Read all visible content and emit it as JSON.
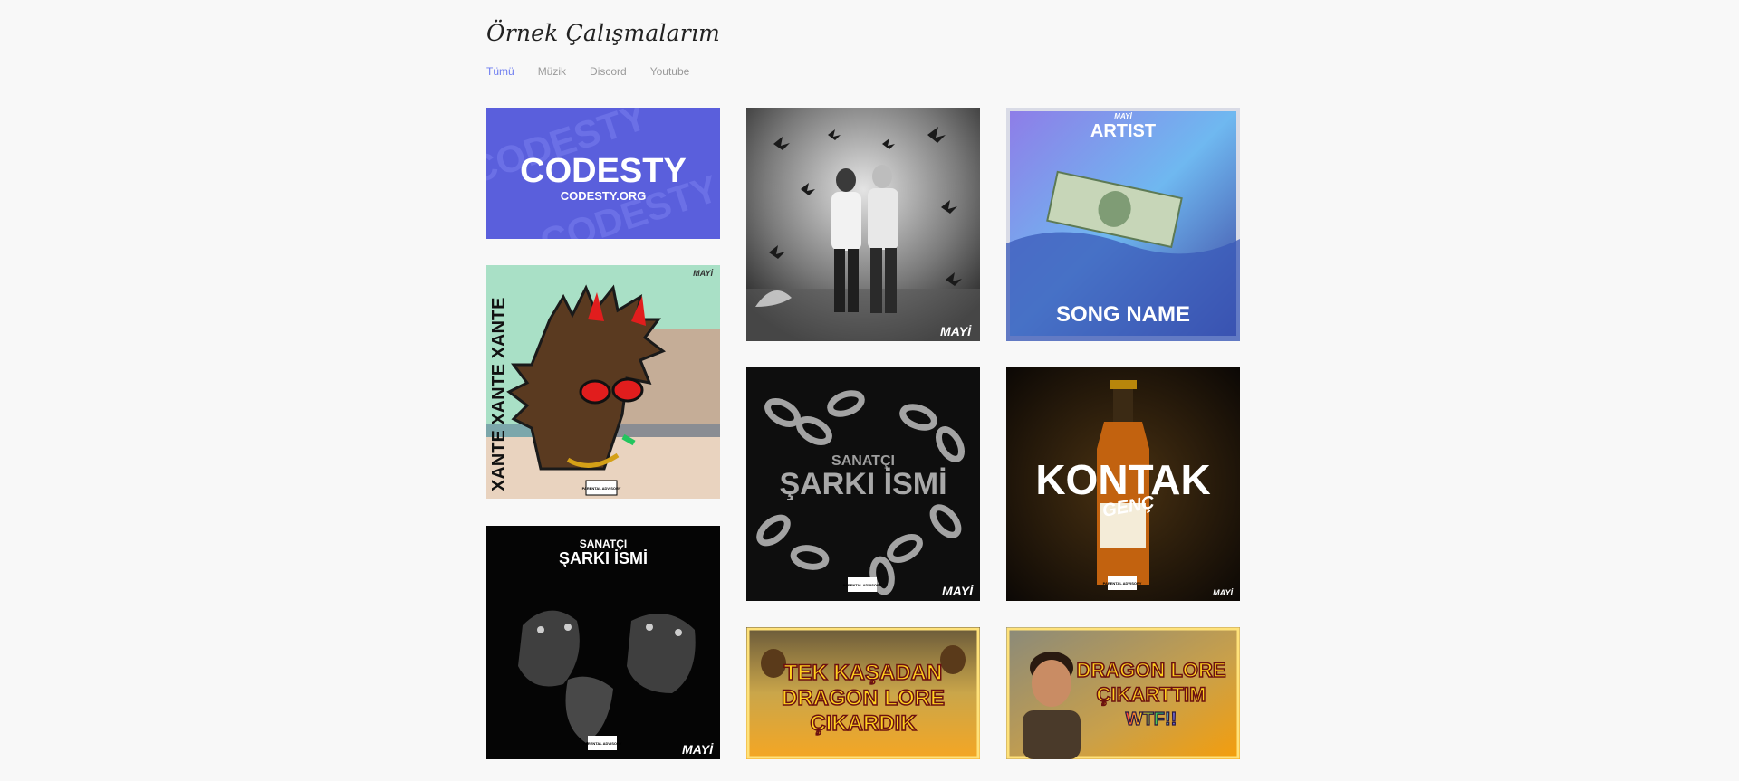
{
  "header": {
    "title": "Örnek Çalışmalarım"
  },
  "filters": [
    {
      "label": "Tümü",
      "active": true
    },
    {
      "label": "Müzik",
      "active": false
    },
    {
      "label": "Discord",
      "active": false
    },
    {
      "label": "Youtube",
      "active": false
    }
  ],
  "portfolio": {
    "codesty": {
      "title": "CODESTY",
      "subtitle": "CODESTY.ORG",
      "bg_text": "CODESTY"
    },
    "duo": {
      "signature": "MAYİ"
    },
    "artist": {
      "top_tag": "MAYİ",
      "artist": "ARTIST",
      "song": "SONG NAME"
    },
    "xante": {
      "side_text": "XANTE XANTE XANTE",
      "signature": "MAYİ",
      "advisory": "PARENTAL ADVISORY"
    },
    "chains": {
      "artist": "SANATÇI",
      "song": "ŞARKI İSMİ",
      "signature": "MAYİ",
      "advisory": "PARENTAL ADVISORY"
    },
    "kontak": {
      "title": "KONTAK",
      "subtitle": "GENÇ",
      "signature": "MAYİ",
      "advisory": "PARENTAL ADVISORY"
    },
    "dogs": {
      "artist": "SANATÇI",
      "song": "ŞARKI İSMİ",
      "signature": "MAYİ",
      "advisory": "PARENTAL ADVISORY"
    },
    "tek": {
      "line1": "TEK KAŞADAN",
      "line2": "DRAGON LORE",
      "line3": "ÇIKARDIK"
    },
    "dragon": {
      "line1": "DRAGON LORE",
      "line2": "ÇIKARTTIM",
      "line3": "WTF!!"
    }
  },
  "colors": {
    "accent": "#6d7cf0",
    "muted": "#9a9a9a",
    "codesty_blue": "#5a5fdc",
    "thumb_yellow": "#ffd21f"
  }
}
